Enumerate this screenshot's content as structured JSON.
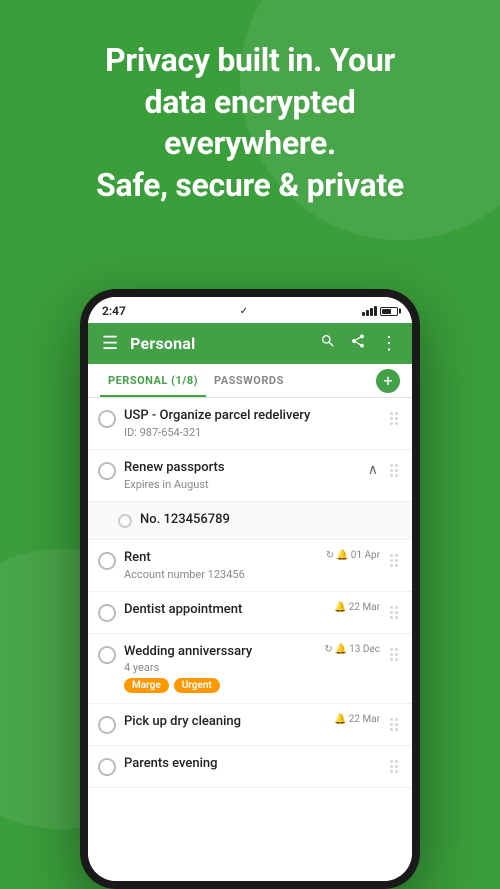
{
  "header": {
    "line1": "Privacy built in. Your",
    "line2": "data encrypted",
    "line3": "everywhere.",
    "line4": "Safe, secure & private"
  },
  "status_bar": {
    "time": "2:47",
    "check": "✓"
  },
  "toolbar": {
    "title": "Personal",
    "menu_icon": "☰",
    "search_icon": "🔍",
    "share_icon": "◁",
    "more_icon": "⋮"
  },
  "tabs": [
    {
      "label": "PERSONAL (1/8)",
      "active": true
    },
    {
      "label": "PASSWORDS",
      "active": false
    }
  ],
  "list_items": [
    {
      "id": 1,
      "title": "USP - Organize parcel redelivery",
      "subtitle": "ID: 987-654-321",
      "date": "",
      "repeat": "",
      "has_expand": false,
      "expanded": false,
      "tags": []
    },
    {
      "id": 2,
      "title": "Renew passports",
      "subtitle": "Expires in August",
      "date": "",
      "repeat": "",
      "has_expand": true,
      "expanded": true,
      "tags": []
    },
    {
      "id": 3,
      "title": "No. 123456789",
      "subtitle": "",
      "date": "",
      "repeat": "",
      "is_child": true,
      "tags": []
    },
    {
      "id": 4,
      "title": "Rent",
      "subtitle": "Account number 123456",
      "date": "01 Apr",
      "repeat": "↻",
      "has_expand": false,
      "expanded": false,
      "tags": []
    },
    {
      "id": 5,
      "title": "Dentist appointment",
      "subtitle": "",
      "date": "22 Mar",
      "repeat": "",
      "has_expand": false,
      "expanded": false,
      "tags": []
    },
    {
      "id": 6,
      "title": "Wedding anniverssary",
      "subtitle": "4 years",
      "date": "13 Dec",
      "repeat": "↻",
      "has_expand": false,
      "expanded": false,
      "tags": [
        "Marge",
        "Urgent"
      ]
    },
    {
      "id": 7,
      "title": "Pick up dry cleaning",
      "subtitle": "",
      "date": "22 Mar",
      "repeat": "",
      "has_expand": false,
      "expanded": false,
      "tags": []
    },
    {
      "id": 8,
      "title": "Parents evening",
      "subtitle": "",
      "date": "",
      "repeat": "",
      "has_expand": false,
      "expanded": false,
      "tags": []
    }
  ],
  "icons": {
    "bell": "🔔",
    "repeat": "↻",
    "chevron_up": "∧",
    "chevron_down": "∨",
    "plus": "+"
  }
}
